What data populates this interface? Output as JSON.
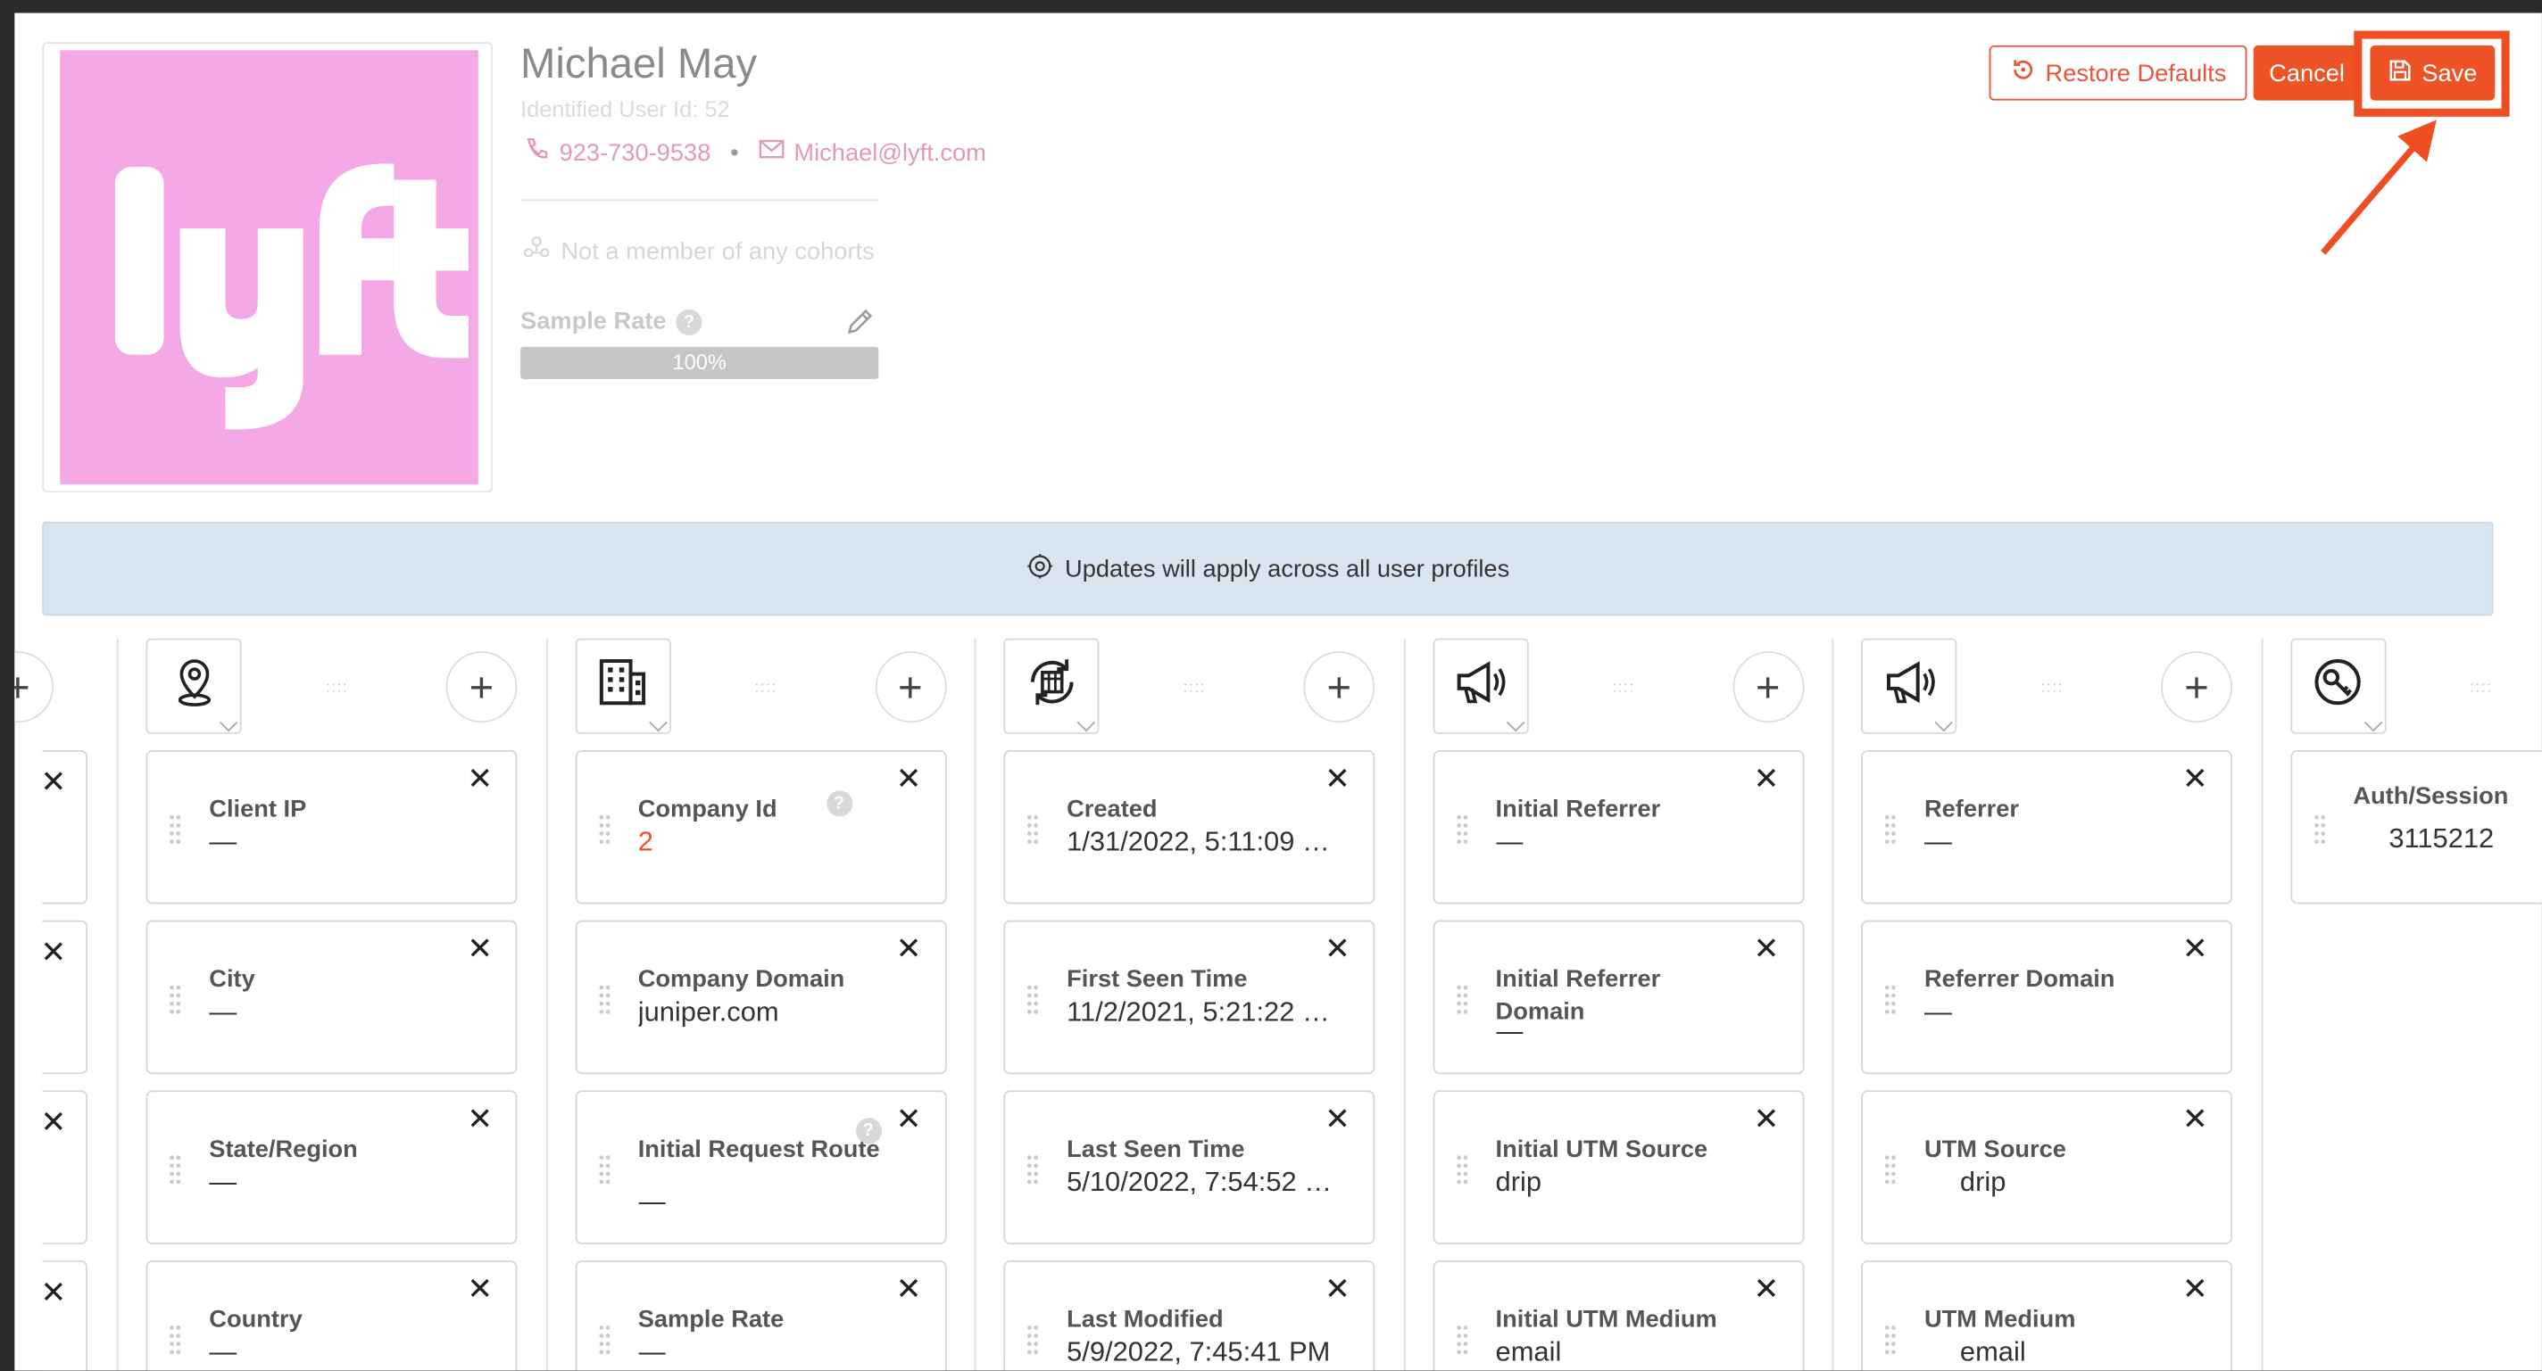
{
  "profile": {
    "name": "Michael May",
    "user_id_text": "Identified User Id: 52",
    "phone": "923-730-9538",
    "email": "Michael@lyft.com",
    "cohorts_text": "Not a member of any cohorts",
    "sample_rate_label": "Sample Rate",
    "sample_rate_value": "100%",
    "sample_rate_fraction": 1.0,
    "logo_text": "lyft",
    "logo_bg": "#f4a9e6"
  },
  "actions": {
    "restore_label": "Restore Defaults",
    "cancel_label": "Cancel",
    "save_label": "Save",
    "accent": "#ee5326"
  },
  "banner": {
    "text": "Updates will apply across all user profiles"
  },
  "columns": [
    {
      "icon": "location-pin-icon",
      "cards": [
        {
          "label": "Client IP",
          "value": "—"
        },
        {
          "label": "City",
          "value": "—"
        },
        {
          "label": "State/Region",
          "value": "—"
        },
        {
          "label": "Country",
          "value": "—"
        }
      ]
    },
    {
      "icon": "building-icon",
      "cards": [
        {
          "label": "Company Id",
          "value": "2"
        },
        {
          "label": "Company Domain",
          "value": "juniper.com"
        },
        {
          "label": "Initial Request Route",
          "value": "—"
        },
        {
          "label": "Sample Rate",
          "value": "—"
        }
      ]
    },
    {
      "icon": "calendar-refresh-icon",
      "cards": [
        {
          "label": "Created",
          "value": "1/31/2022, 5:11:09 …"
        },
        {
          "label": "First Seen Time",
          "value": "11/2/2021, 5:21:22 …"
        },
        {
          "label": "Last Seen Time",
          "value": "5/10/2022, 7:54:52 …"
        },
        {
          "label": "Last Modified",
          "value": "5/9/2022, 7:45:41 PM"
        }
      ]
    },
    {
      "icon": "megaphone-icon",
      "cards": [
        {
          "label": "Initial Referrer",
          "value": "—"
        },
        {
          "label": "Initial Referrer Domain",
          "value": "—"
        },
        {
          "label": "Initial UTM Source",
          "value": "drip"
        },
        {
          "label": "Initial UTM Medium",
          "value": "email"
        }
      ]
    },
    {
      "icon": "megaphone-icon",
      "cards": [
        {
          "label": "Referrer",
          "value": "—"
        },
        {
          "label": "Referrer Domain",
          "value": "—"
        },
        {
          "label": "UTM Source",
          "value": "drip"
        },
        {
          "label": "UTM Medium",
          "value": "email"
        }
      ]
    },
    {
      "icon": "key-icon",
      "cards": [
        {
          "label": "Auth/Session",
          "value": "3115212"
        }
      ]
    }
  ]
}
